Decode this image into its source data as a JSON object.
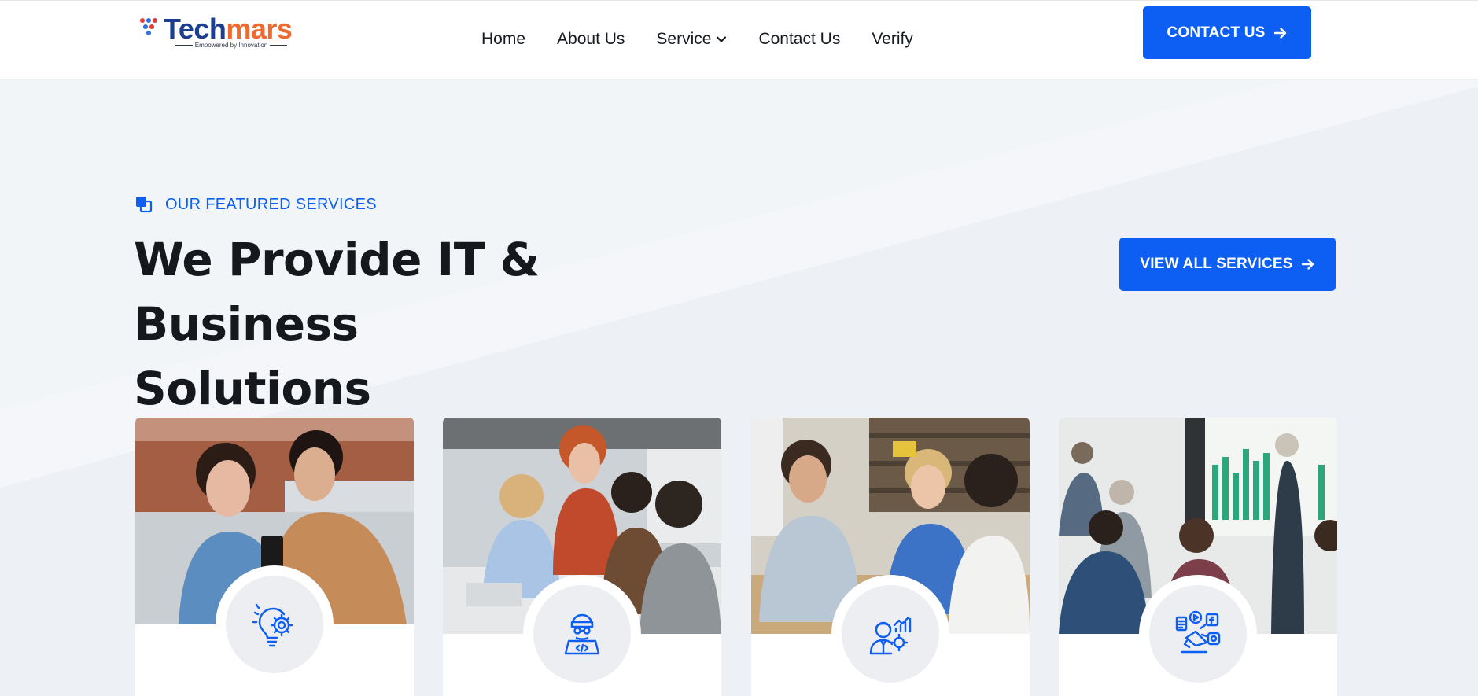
{
  "brand": {
    "name_part1": "Tech",
    "name_part2": "mars",
    "tagline": "Empowered by Innovation",
    "colors": {
      "primary_blue": "#1d3e8f",
      "accent_orange": "#ee6a30",
      "dot_red": "#e63a3a",
      "dot_blue": "#2f6fe0"
    }
  },
  "nav": {
    "items": [
      {
        "label": "Home"
      },
      {
        "label": "About Us"
      },
      {
        "label": "Service",
        "has_dropdown": true,
        "icon": "chevron-down-icon"
      },
      {
        "label": "Contact Us"
      },
      {
        "label": "Verify"
      }
    ]
  },
  "header_cta": {
    "label": "CONTACT US",
    "icon": "arrow-right-icon"
  },
  "section": {
    "eyebrow_icon": "copy-squares-icon",
    "eyebrow": "OUR FEATURED SERVICES",
    "title_line1": "We Provide IT & Business",
    "title_line2": "Solutions",
    "cta_label": "VIEW ALL SERVICES",
    "cta_icon": "arrow-right-icon"
  },
  "cards": [
    {
      "photo": "two colleagues looking at a smartphone",
      "icon": "lightbulb-gear-icon"
    },
    {
      "photo": "team collaborating around a table with laptops",
      "icon": "developer-code-icon"
    },
    {
      "photo": "business handshake at a meeting table",
      "icon": "business-analyst-icon"
    },
    {
      "photo": "presenter showing charts to an audience",
      "icon": "digital-marketing-icon"
    }
  ],
  "theme": {
    "accent": "#0d5ef2",
    "page_bg": "#f2f5f8",
    "icon_bg": "#eceef2"
  }
}
